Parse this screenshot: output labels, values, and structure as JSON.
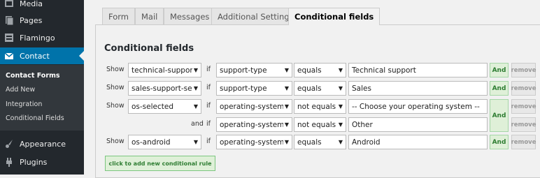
{
  "sidebar": {
    "items": [
      {
        "label": "Media",
        "icon": "media-icon"
      },
      {
        "label": "Pages",
        "icon": "pages-icon"
      },
      {
        "label": "Flamingo",
        "icon": "flamingo-icon"
      },
      {
        "label": "Contact",
        "icon": "mail-icon",
        "active": true
      },
      {
        "label": "Appearance",
        "icon": "paintbrush-icon"
      },
      {
        "label": "Plugins",
        "icon": "plug-icon"
      }
    ],
    "submenu": [
      "Contact Forms",
      "Add New",
      "Integration",
      "Conditional Fields"
    ]
  },
  "tabs": [
    "Form",
    "Mail",
    "Messages",
    "Additional Settings",
    "Conditional fields"
  ],
  "conditional": {
    "title": "Conditional fields",
    "show_label": "Show",
    "if_label": "if",
    "and_label": "and",
    "and_button": "And",
    "remove_button": "remove",
    "add_rule": "click to add new conditional rule",
    "rows": [
      {
        "group": "technical-suppor",
        "field": "support-type",
        "operator": "equals",
        "value": "Technical support"
      },
      {
        "group": "sales-support-se",
        "field": "support-type",
        "operator": "equals",
        "value": "Sales"
      },
      {
        "group": "os-selected",
        "field": "operating-system",
        "operator": "not equals",
        "value": "-- Choose your operating system --"
      },
      {
        "group": "",
        "field": "operating-system",
        "operator": "not equals",
        "value": "Other"
      },
      {
        "group": "os-android",
        "field": "operating-system",
        "operator": "equals",
        "value": "Android"
      }
    ]
  },
  "colors": {
    "sidebar_bg": "#23282d",
    "active_blue": "#0073aa",
    "green": "#2e7d32"
  }
}
